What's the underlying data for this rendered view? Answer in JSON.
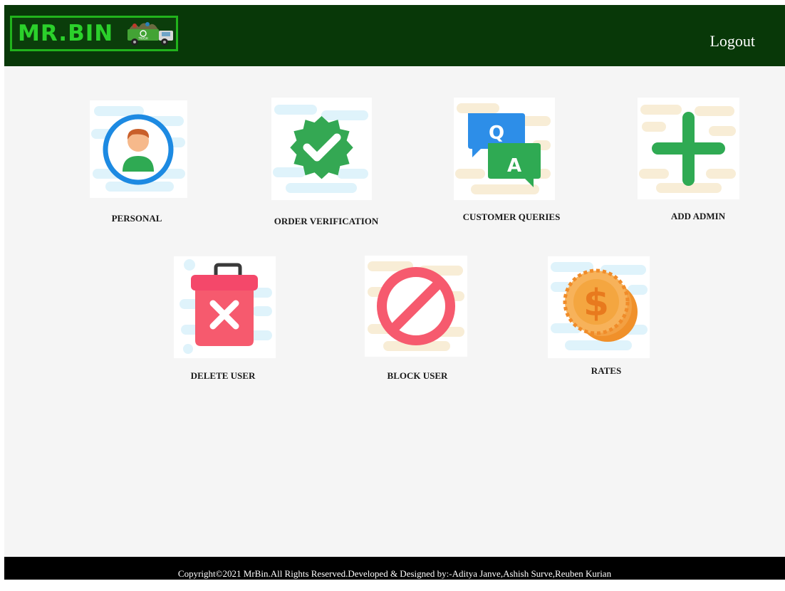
{
  "header": {
    "logo_text": "MR.BIN",
    "logo_badge": "TRASH",
    "logout_label": "Logout"
  },
  "tiles": [
    {
      "label": "PERSONAL",
      "icon": "user-avatar-icon"
    },
    {
      "label": "ORDER VERIFICATION",
      "icon": "verified-badge-icon"
    },
    {
      "label": "CUSTOMER QUERIES",
      "icon": "qa-chat-icon",
      "q": "Q",
      "a": "A"
    },
    {
      "label": "ADD ADMIN",
      "icon": "plus-icon"
    },
    {
      "label": "DELETE USER",
      "icon": "trash-delete-icon"
    },
    {
      "label": "BLOCK USER",
      "icon": "block-icon"
    },
    {
      "label": "RATES",
      "icon": "coins-icon",
      "symbol": "$"
    }
  ],
  "footer": {
    "text": "Copyright©2021 MrBin.All Rights Reserved.Developed & Designed by:-Aditya Janve,Ashish Surve,Reuben Kurian"
  },
  "colors": {
    "header_bg": "#083808",
    "logo_green": "#2bd12b",
    "page_bg": "#f5f5f5",
    "footer_bg": "#000000"
  }
}
